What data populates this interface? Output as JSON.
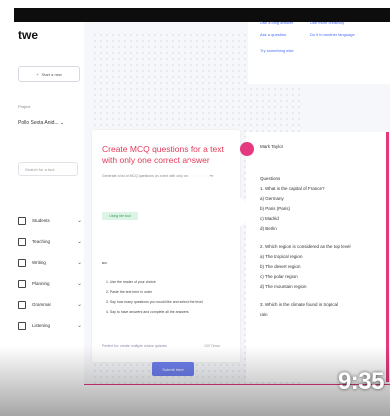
{
  "sidebar": {
    "logo": "twe",
    "new_button": "Start a new",
    "project_label": "Project",
    "project_value": "Pollo Sexta Anid...",
    "search_placeholder": "Search for a tool",
    "nav": [
      {
        "label": "Students",
        "icon": "students-icon"
      },
      {
        "label": "Teaching",
        "icon": "book-icon"
      },
      {
        "label": "Writing",
        "icon": "pencil-icon"
      },
      {
        "label": "Planning",
        "icon": "calendar-icon"
      },
      {
        "label": "Grammar",
        "icon": "grammar-icon"
      },
      {
        "label": "Listening",
        "icon": "headphones-icon"
      }
    ]
  },
  "chips": [
    {
      "text": "Use a long answer"
    },
    {
      "text": "Use more creativity"
    },
    {
      "text": "Ask a question"
    },
    {
      "text": "Do it in another language"
    },
    {
      "text": "Try something else"
    }
  ],
  "prompt_card": {
    "title": "Create MCQ questions for a text with only one correct answer",
    "subtitle": "Generate a list of MCQ questions on a text with only one correct answer",
    "tag": "Using the tool",
    "quote_mark": "““",
    "list": [
      "1. Use the reader of your choice",
      "2. Paste the text here in order",
      "3. Say how many questions you would like and select the level",
      "4. Say to have answers and complete all the answers"
    ],
    "footer": "Perfect for: create multiple choice quizzes",
    "footer_right": "100 Times",
    "cta": "Submit here"
  },
  "response": {
    "name": "Mark Taylor",
    "lines": [
      "Questions",
      "1. What is the capital of France?",
      "a) Germany",
      "b) Paris (Paris)",
      "c) Madrid",
      "d) Berlin",
      "",
      "2. Which region is considered as the top level",
      "a) The tropical region",
      "b) The desert region",
      "c) The polar region",
      "d) The mountain region",
      "",
      "3. Which is the climate found in tropical",
      "rain"
    ]
  },
  "video": {
    "duration": "9:35"
  }
}
